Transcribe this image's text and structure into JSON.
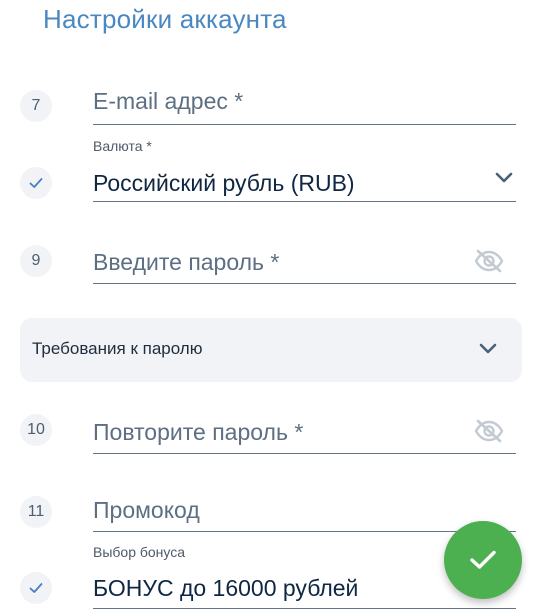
{
  "header": {
    "title": "Настройки аккаунта"
  },
  "colors": {
    "title": "#4a88c2",
    "step_bg": "#f1f3f6",
    "underline": "#667585",
    "fab": "#4caf50"
  },
  "form": {
    "email": {
      "step": "7",
      "placeholder": "E-mail адрес *"
    },
    "currency": {
      "step_icon": "check-icon",
      "label": "Валюта *",
      "value": "Российский рубль (RUB)",
      "dropdown_icon": "chevron-down-icon"
    },
    "password": {
      "step": "9",
      "placeholder": "Введите пароль *",
      "toggle_icon": "eye-off-icon"
    },
    "password_requirements": {
      "label": "Требования к паролю",
      "expand_icon": "chevron-down-icon"
    },
    "password_repeat": {
      "step": "10",
      "placeholder": "Повторите пароль *",
      "toggle_icon": "eye-off-icon"
    },
    "promo": {
      "step": "11",
      "placeholder": "Промокод"
    },
    "bonus": {
      "step_icon": "check-icon",
      "label": "Выбор бонуса",
      "value": "БОНУС до 16000 рублей"
    }
  },
  "fab": {
    "icon": "check-icon"
  }
}
